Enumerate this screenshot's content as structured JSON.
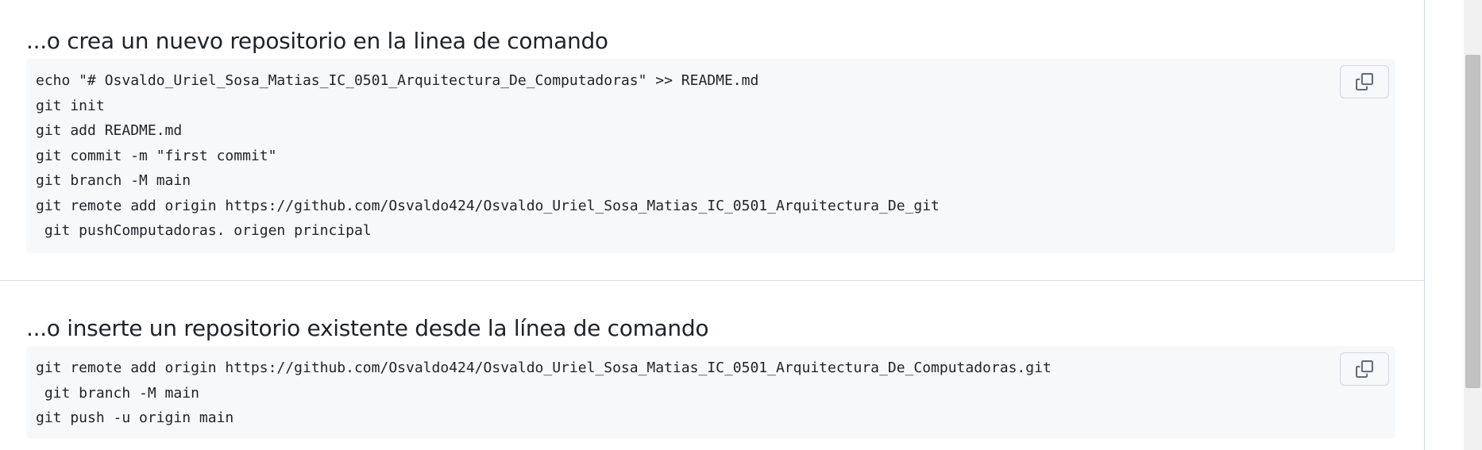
{
  "sections": [
    {
      "heading": "...o crea un nuevo repositorio en la linea de comando",
      "code": "echo \"# Osvaldo_Uriel_Sosa_Matias_IC_0501_Arquitectura_De_Computadoras\" >> README.md\ngit init\ngit add README.md\ngit commit -m \"first commit\"\ngit branch -M main\ngit remote add origin https://github.com/Osvaldo424/Osvaldo_Uriel_Sosa_Matias_IC_0501_Arquitectura_De_git\n git pushComputadoras. origen principal",
      "copy_icon": "copy-icon"
    },
    {
      "heading": "...o inserte un repositorio existente desde la línea de comando",
      "code": "git remote add origin https://github.com/Osvaldo424/Osvaldo_Uriel_Sosa_Matias_IC_0501_Arquitectura_De_Computadoras.git\n git branch -M main\ngit push -u origin main",
      "copy_icon": "copy-icon"
    }
  ],
  "colors": {
    "code_background": "#f6f8fa",
    "border": "#d0d7de",
    "text": "#1f2328",
    "icon": "#656d76"
  }
}
